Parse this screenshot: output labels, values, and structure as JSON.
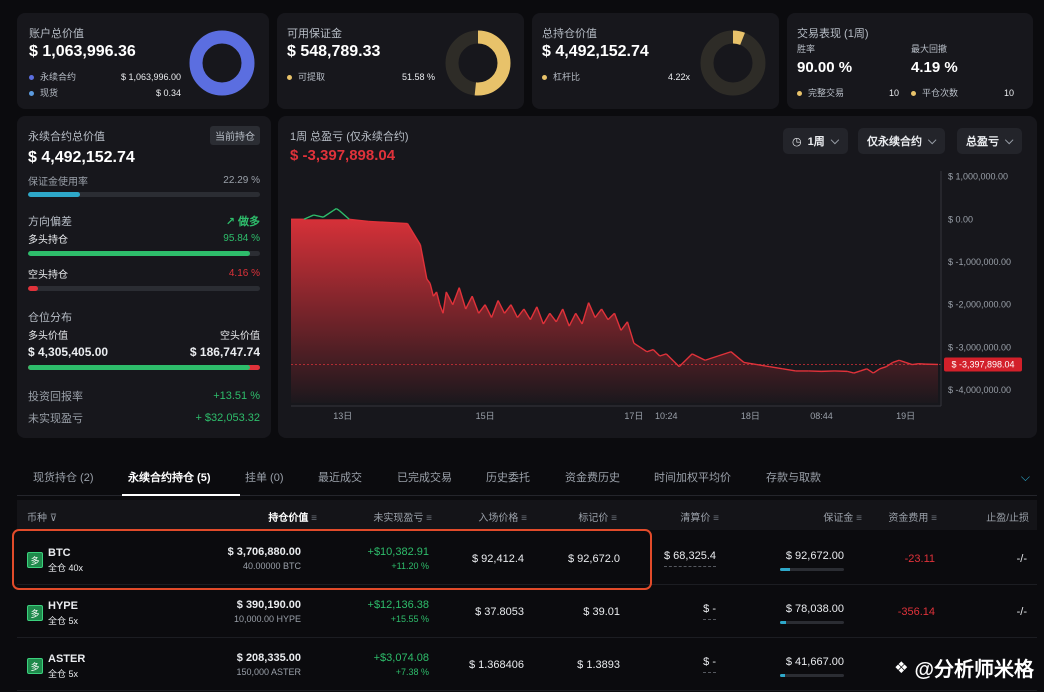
{
  "cards": {
    "account": {
      "title": "账户总价值",
      "value": "$ 1,063,996.36",
      "legend": [
        {
          "label": "永续合约",
          "value": "$ 1,063,996.00",
          "color": "#5b6ee0"
        },
        {
          "label": "现货",
          "value": "$ 0.34",
          "color": "#5b9be0"
        }
      ],
      "ring_fraction": 0.999,
      "ring_color": "#5b6ee0"
    },
    "margin": {
      "title": "可用保证金",
      "value": "$ 548,789.33",
      "legend_label": "可提取",
      "legend_value": "51.58 %",
      "legend_color": "#e8c26a",
      "ring_fraction": 0.5158,
      "ring_color": "#e8c26a"
    },
    "position": {
      "title": "总持仓价值",
      "value": "$ 4,492,152.74",
      "legend_label": "杠杆比",
      "legend_value": "4.22x",
      "legend_color": "#e8c26a",
      "ring_fraction": 0.06,
      "ring_color": "#e8c26a"
    },
    "perf": {
      "title": "交易表现 (1周)",
      "win_label": "胜率",
      "win_value": "90.00 %",
      "dd_label": "最大回撤",
      "dd_value": "4.19 %",
      "done_label": "完整交易",
      "done_value": "10",
      "close_label": "平仓次数",
      "close_value": "10",
      "dot_color": "#e8c26a"
    }
  },
  "left": {
    "perp_title": "永续合约总价值",
    "perp_tag": "当前持仓",
    "perp_value": "$ 4,492,152.74",
    "margin_use_label": "保证金使用率",
    "margin_use_value": "22.29 %",
    "margin_use_fraction": 0.2229,
    "bias_label": "方向偏差",
    "bias_value": "做多",
    "long_label": "多头持仓",
    "long_value": "95.84 %",
    "long_fraction": 0.9584,
    "short_label": "空头持仓",
    "short_value": "4.16 %",
    "short_fraction": 0.0416,
    "dist_label": "仓位分布",
    "long_val_label": "多头价值",
    "short_val_label": "空头价值",
    "long_val": "$ 4,305,405.00",
    "short_val": "$ 186,747.74",
    "dist_long_fraction": 0.958,
    "roi_label": "投资回报率",
    "roi_value": "+13.51 %",
    "upnl_label": "未实现盈亏",
    "upnl_value": "+ $32,053.32"
  },
  "chart": {
    "title": "1周 总盈亏 (仅永续合约)",
    "value": "$ -3,397,898.04",
    "controls": [
      "1周",
      "仅永续合约",
      "总盈亏"
    ],
    "last_label": "$ -3,397,898.04"
  },
  "chart_data": {
    "type": "area",
    "title": "1周 总盈亏 (仅永续合约)",
    "y_ticks": [
      "$ 1,000,000.00",
      "$ 0.00",
      "$ -1,000,000.00",
      "$ -2,000,000.00",
      "$ -3,000,000.00",
      "$ -4,000,000.00"
    ],
    "y_tick_values": [
      1000000,
      0,
      -1000000,
      -2000000,
      -3000000,
      -4000000
    ],
    "ylim": [
      -4300000,
      1200000
    ],
    "x_ticks": [
      "13日",
      "15日",
      "17日",
      "10:24",
      "18日",
      "08:44",
      "19日"
    ],
    "x_tick_positions": [
      0.08,
      0.3,
      0.53,
      0.58,
      0.71,
      0.82,
      0.95
    ],
    "xlim": [
      0,
      1
    ],
    "positive_color": "#2ebd6b",
    "negative_color": "#e0323a",
    "last_value": -3397898.04,
    "series": [
      {
        "x": [
          0,
          0.02,
          0.035,
          0.05,
          0.065,
          0.07,
          0.075,
          0.09,
          0.12,
          0.18,
          0.2,
          0.21,
          0.215,
          0.22,
          0.225,
          0.23,
          0.235,
          0.24,
          0.25,
          0.26,
          0.27,
          0.28,
          0.29,
          0.3,
          0.31,
          0.32,
          0.33,
          0.34,
          0.35,
          0.36,
          0.37,
          0.38,
          0.39,
          0.4,
          0.41,
          0.42,
          0.43,
          0.44,
          0.45,
          0.46,
          0.47,
          0.48,
          0.49,
          0.5,
          0.51,
          0.52,
          0.53,
          0.54,
          0.55,
          0.56,
          0.57,
          0.58,
          0.6,
          0.62,
          0.64,
          0.66,
          0.68,
          0.7,
          0.72,
          0.74,
          0.76,
          0.78,
          0.8,
          0.82,
          0.84,
          0.86,
          0.87,
          0.88,
          0.89,
          0.9,
          0.91,
          0.92,
          0.93,
          0.94,
          0.95,
          0.96,
          0.97,
          0.98,
          1.0
        ],
        "y": [
          0,
          0,
          100000,
          50000,
          200000,
          250000,
          200000,
          0,
          -50000,
          -100000,
          -600000,
          -1400000,
          -1500000,
          -1800000,
          -1700000,
          -2000000,
          -2200000,
          -1700000,
          -2000000,
          -1600000,
          -2100000,
          -1800000,
          -2200000,
          -2000000,
          -2300000,
          -1900000,
          -2200000,
          -2000000,
          -2300000,
          -2100000,
          -2350000,
          -2050000,
          -2450000,
          -2200000,
          -2400000,
          -2100000,
          -2500000,
          -2200000,
          -2450000,
          -1950000,
          -2300000,
          -2100000,
          -2350000,
          -2200000,
          -2600000,
          -2400000,
          -2900000,
          -3000000,
          -3100000,
          -3050000,
          -3200000,
          -3150000,
          -3450000,
          -3150000,
          -3300000,
          -3200000,
          -3100000,
          -3350000,
          -3400000,
          -3450000,
          -3500000,
          -3550000,
          -3550000,
          -3560000,
          -3550000,
          -3560000,
          -3600000,
          -3550000,
          -3500000,
          -3600000,
          -3500000,
          -3450000,
          -3350000,
          -3300000,
          -3350000,
          -3400000,
          -3380000,
          -3390000,
          -3397898.04
        ]
      }
    ]
  },
  "tabs": [
    {
      "label": "现货持仓 (2)",
      "active": false
    },
    {
      "label": "永续合约持仓 (5)",
      "active": true
    },
    {
      "label": "挂单 (0)",
      "active": false
    },
    {
      "label": "最近成交",
      "active": false
    },
    {
      "label": "已完成交易",
      "active": false
    },
    {
      "label": "历史委托",
      "active": false
    },
    {
      "label": "资金费历史",
      "active": false
    },
    {
      "label": "时间加权平均价",
      "active": false
    },
    {
      "label": "存款与取款",
      "active": false
    }
  ],
  "table": {
    "headers": [
      "币种",
      "持仓价值",
      "未实现盈亏",
      "入场价格",
      "标记价",
      "清算价",
      "保证金",
      "资金费用",
      "止盈/止损"
    ],
    "long_badge": "多",
    "rows": [
      {
        "coin": "BTC",
        "mode": "全仓 40x",
        "value": "$ 3,706,880.00",
        "size": "40.00000 BTC",
        "pnl": "+$10,382.91",
        "pnl_pct": "+11.20 %",
        "entry": "$ 92,412.4",
        "mark": "$ 92,672.0",
        "liq": "$ 68,325.4",
        "margin": "$ 92,672.00",
        "margin_fraction": 0.15,
        "funding": "-23.11",
        "tpsl": "-/-"
      },
      {
        "coin": "HYPE",
        "mode": "全仓 5x",
        "value": "$ 390,190.00",
        "size": "10,000.00 HYPE",
        "pnl": "+$12,136.38",
        "pnl_pct": "+15.55 %",
        "entry": "$ 37.8053",
        "mark": "$ 39.01",
        "liq": "$ -",
        "margin": "$ 78,038.00",
        "margin_fraction": 0.1,
        "funding": "-356.14",
        "tpsl": "-/-"
      },
      {
        "coin": "ASTER",
        "mode": "全仓 5x",
        "value": "$ 208,335.00",
        "size": "150,000 ASTER",
        "pnl": "+$3,074.08",
        "pnl_pct": "+7.38 %",
        "entry": "$ 1.368406",
        "mark": "$ 1.3893",
        "liq": "$ -",
        "margin": "$ 41,667.00",
        "margin_fraction": 0.08,
        "funding": "",
        "tpsl": ""
      }
    ]
  },
  "watermark": "@分析师米格"
}
